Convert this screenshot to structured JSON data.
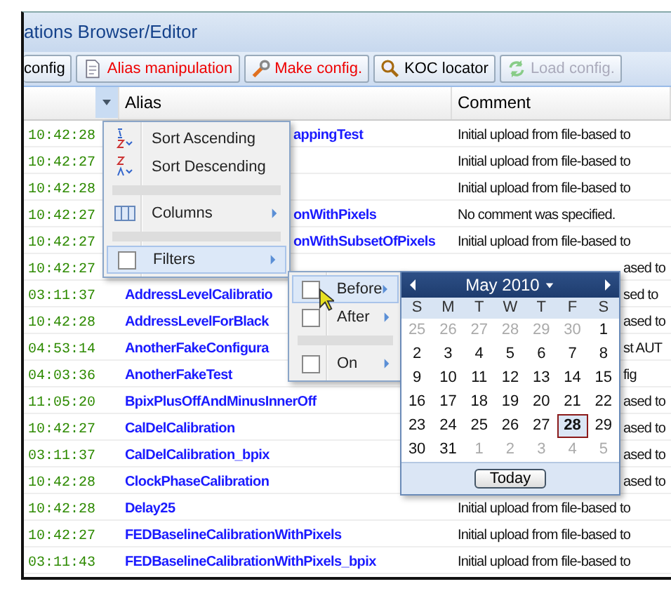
{
  "window": {
    "title": "ations Browser/Editor"
  },
  "toolbar": [
    {
      "label": "config",
      "alert": false,
      "disabled": false
    },
    {
      "label": "Alias manipulation",
      "alert": true,
      "disabled": false
    },
    {
      "label": "Make config.",
      "alert": true,
      "disabled": false
    },
    {
      "label": "KOC locator",
      "alert": false,
      "disabled": false
    },
    {
      "label": "Load config.",
      "alert": false,
      "disabled": true
    }
  ],
  "table": {
    "columns": [
      "Alias",
      "Comment"
    ],
    "rows": [
      {
        "time": "10:42:28",
        "alias": "appingTest",
        "alias_clipped": true,
        "comment": "Initial upload from file-based to",
        "comment_clipped": false
      },
      {
        "time": "10:42:27",
        "comment": "Initial upload from file-based to",
        "comment_clipped": false
      },
      {
        "time": "10:42:28",
        "comment": "Initial upload from file-based to",
        "comment_clipped": false
      },
      {
        "time": "10:42:27",
        "alias": "onWithPixels",
        "alias_clipped": true,
        "comment": "No comment was specified.",
        "comment_clipped": false
      },
      {
        "time": "10:42:27",
        "alias": "onWithSubsetOfPixels",
        "alias_clipped": true,
        "comment": "Initial upload from file-based to",
        "comment_clipped": false
      },
      {
        "time": "10:42:27",
        "comment": "ased to",
        "comment_clipped": true
      },
      {
        "time": "03:11:37",
        "alias": "AddressLevelCalibratio",
        "alias_clipped": false,
        "comment": "sed to",
        "comment_clipped": true
      },
      {
        "time": "10:42:28",
        "alias": "AddressLevelForBlack",
        "alias_clipped": false,
        "comment": "ased to",
        "comment_clipped": true
      },
      {
        "time": "04:53:14",
        "alias": "AnotherFakeConfigura",
        "alias_clipped": false,
        "comment": "st AUT",
        "comment_clipped": true
      },
      {
        "time": "04:03:36",
        "alias": "AnotherFakeTest",
        "alias_clipped": false,
        "comment": "fig",
        "comment_clipped": true
      },
      {
        "time": "11:05:20",
        "alias": "BpixPlusOffAndMinusInnerOff",
        "alias_clipped": false,
        "comment": "ased to",
        "comment_clipped": true
      },
      {
        "time": "10:42:27",
        "alias": "CalDelCalibration",
        "alias_clipped": false,
        "comment": "ased to",
        "comment_clipped": true
      },
      {
        "time": "03:11:37",
        "alias": "CalDelCalibration_bpix",
        "alias_clipped": false,
        "comment": "ased to",
        "comment_clipped": true
      },
      {
        "time": "10:42:28",
        "alias": "ClockPhaseCalibration",
        "alias_clipped": false,
        "comment": "ased to",
        "comment_clipped": true
      },
      {
        "time": "10:42:28",
        "alias": "Delay25",
        "comment": "Initial upload from file-based to",
        "comment_clipped": false
      },
      {
        "time": "10:42:27",
        "alias": "FEDBaselineCalibrationWithPixels",
        "comment": "Initial upload from file-based to",
        "comment_clipped": false
      },
      {
        "time": "03:11:43",
        "alias": "FEDBaselineCalibrationWithPixels_bpix",
        "comment": "Initial upload from file-based to",
        "comment_clipped": false
      }
    ]
  },
  "column_menu": {
    "items": [
      {
        "kind": "sort-asc",
        "label": "Sort Ascending",
        "selected": false
      },
      {
        "kind": "sort-desc",
        "label": "Sort Descending",
        "selected": false
      },
      {
        "kind": "separator"
      },
      {
        "kind": "columns",
        "label": "Columns",
        "selected": false
      },
      {
        "kind": "separator"
      },
      {
        "kind": "filters",
        "label": "Filters",
        "selected": true,
        "checked": false
      }
    ]
  },
  "filter_menu": {
    "items": [
      {
        "kind": "option",
        "label": "Before",
        "selected": true,
        "checked": false
      },
      {
        "kind": "option",
        "label": "After",
        "selected": false,
        "checked": false
      },
      {
        "kind": "separator"
      },
      {
        "kind": "option",
        "label": "On",
        "selected": false,
        "checked": false
      }
    ]
  },
  "calendar": {
    "month": "May 2010",
    "weekdays": [
      "S",
      "M",
      "T",
      "W",
      "T",
      "F",
      "S"
    ],
    "weeks": [
      [
        {
          "day": "25",
          "muted": true,
          "selected": false
        },
        {
          "day": "26",
          "muted": true,
          "selected": false
        },
        {
          "day": "27",
          "muted": true,
          "selected": false
        },
        {
          "day": "28",
          "muted": true,
          "selected": false
        },
        {
          "day": "29",
          "muted": true,
          "selected": false
        },
        {
          "day": "30",
          "muted": true,
          "selected": false
        },
        {
          "day": "1",
          "muted": false,
          "selected": false
        }
      ],
      [
        {
          "day": "2",
          "muted": false,
          "selected": false
        },
        {
          "day": "3",
          "muted": false,
          "selected": false
        },
        {
          "day": "4",
          "muted": false,
          "selected": false
        },
        {
          "day": "5",
          "muted": false,
          "selected": false
        },
        {
          "day": "6",
          "muted": false,
          "selected": false
        },
        {
          "day": "7",
          "muted": false,
          "selected": false
        },
        {
          "day": "8",
          "muted": false,
          "selected": false
        }
      ],
      [
        {
          "day": "9",
          "muted": false,
          "selected": false
        },
        {
          "day": "10",
          "muted": false,
          "selected": false
        },
        {
          "day": "11",
          "muted": false,
          "selected": false
        },
        {
          "day": "12",
          "muted": false,
          "selected": false
        },
        {
          "day": "13",
          "muted": false,
          "selected": false
        },
        {
          "day": "14",
          "muted": false,
          "selected": false
        },
        {
          "day": "15",
          "muted": false,
          "selected": false
        }
      ],
      [
        {
          "day": "16",
          "muted": false,
          "selected": false
        },
        {
          "day": "17",
          "muted": false,
          "selected": false
        },
        {
          "day": "18",
          "muted": false,
          "selected": false
        },
        {
          "day": "19",
          "muted": false,
          "selected": false
        },
        {
          "day": "20",
          "muted": false,
          "selected": false
        },
        {
          "day": "21",
          "muted": false,
          "selected": false
        },
        {
          "day": "22",
          "muted": false,
          "selected": false
        }
      ],
      [
        {
          "day": "23",
          "muted": false,
          "selected": false
        },
        {
          "day": "24",
          "muted": false,
          "selected": false
        },
        {
          "day": "25",
          "muted": false,
          "selected": false
        },
        {
          "day": "26",
          "muted": false,
          "selected": false
        },
        {
          "day": "27",
          "muted": false,
          "selected": false
        },
        {
          "day": "28",
          "muted": false,
          "selected": true
        },
        {
          "day": "29",
          "muted": false,
          "selected": false
        }
      ],
      [
        {
          "day": "30",
          "muted": false,
          "selected": false
        },
        {
          "day": "31",
          "muted": false,
          "selected": false
        },
        {
          "day": "1",
          "muted": true,
          "selected": false
        },
        {
          "day": "2",
          "muted": true,
          "selected": false
        },
        {
          "day": "3",
          "muted": true,
          "selected": false
        },
        {
          "day": "4",
          "muted": true,
          "selected": false
        },
        {
          "day": "5",
          "muted": true,
          "selected": false
        }
      ]
    ],
    "today_button": "Today"
  }
}
